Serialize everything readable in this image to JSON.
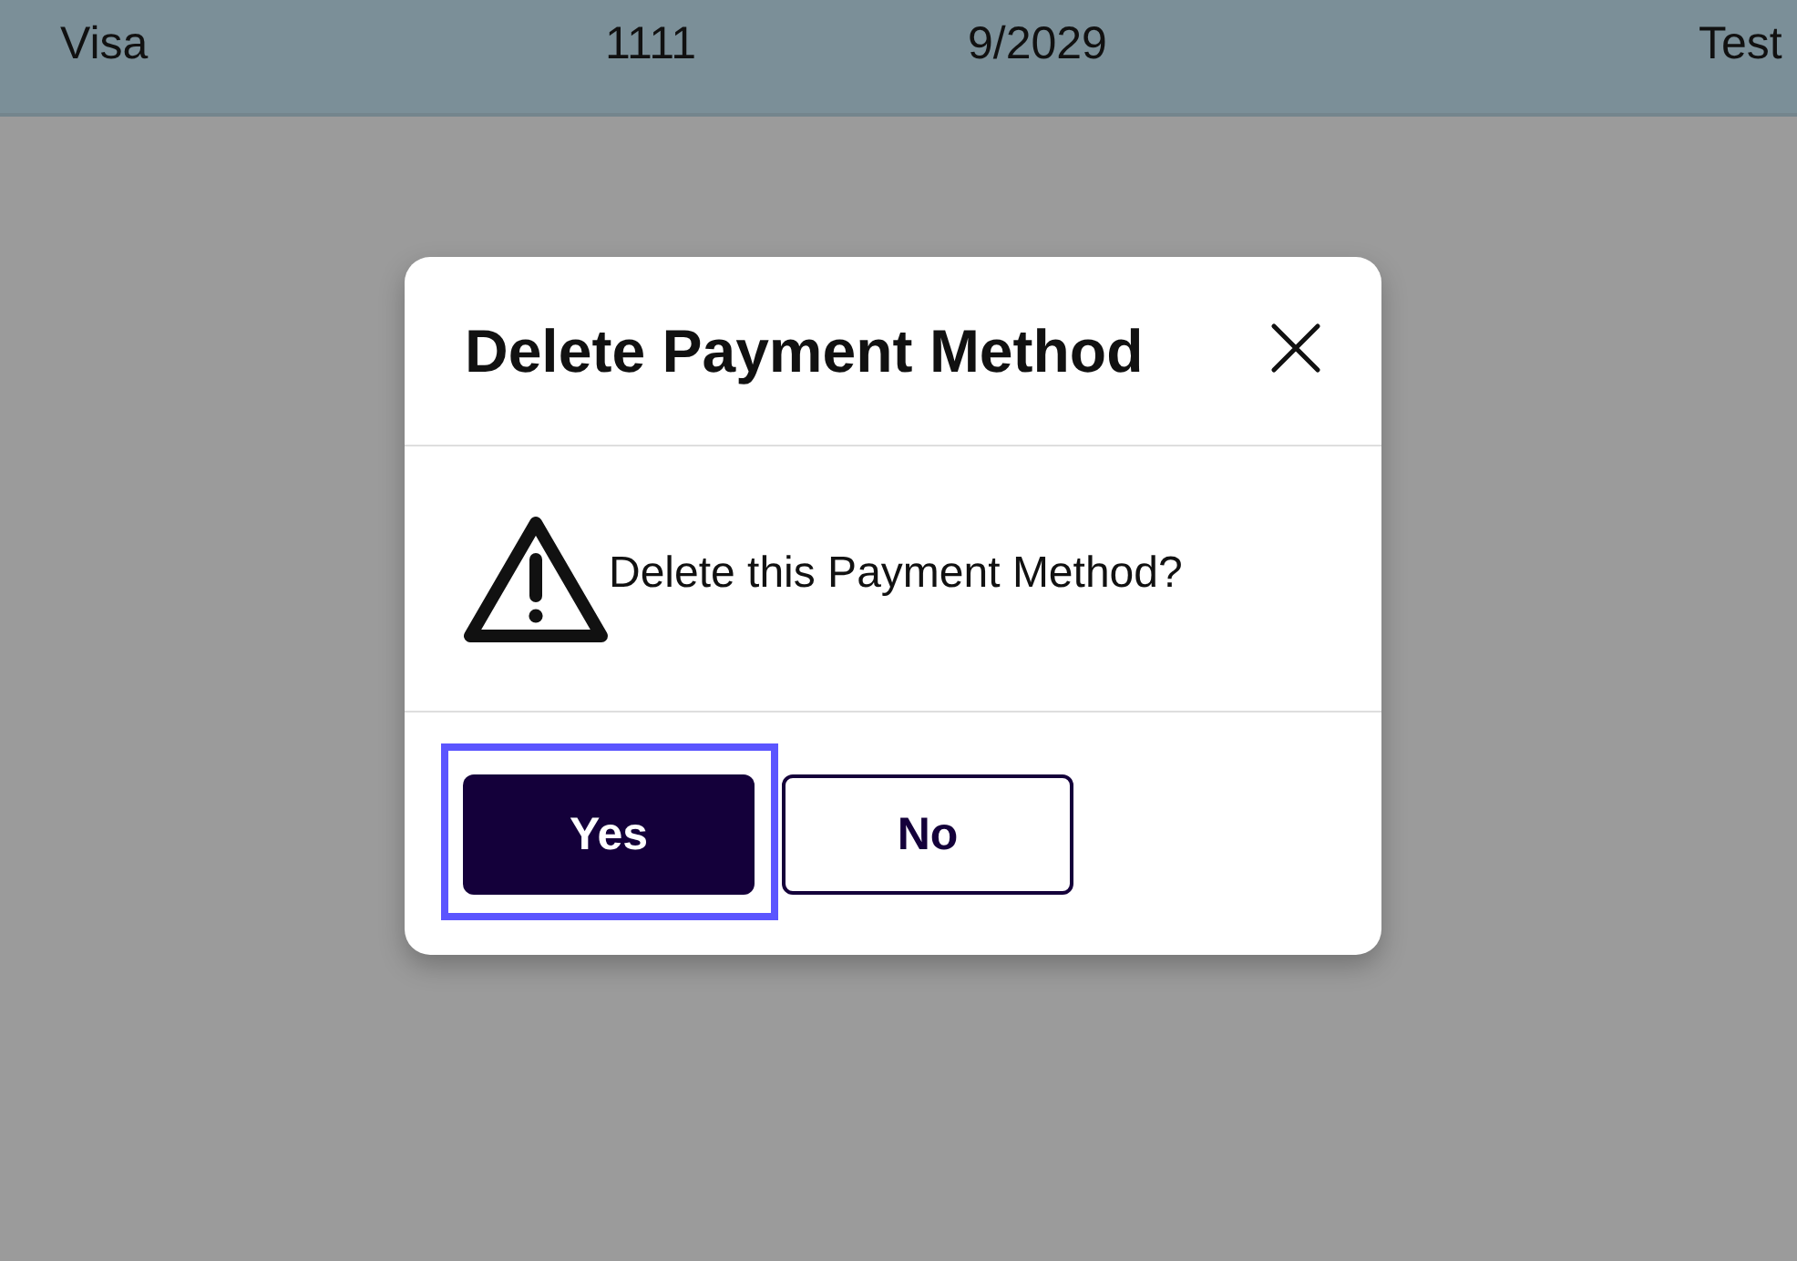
{
  "table": {
    "rows": [
      {
        "cells": [
          "Visa",
          "1111",
          "9/2029",
          "Test"
        ]
      }
    ]
  },
  "dialog": {
    "title": "Delete Payment Method",
    "message": "Delete this Payment Method?",
    "buttons": [
      {
        "label": "Yes",
        "kind": "primary",
        "focused": true
      },
      {
        "label": "No",
        "kind": "secondary",
        "focused": false
      }
    ]
  }
}
